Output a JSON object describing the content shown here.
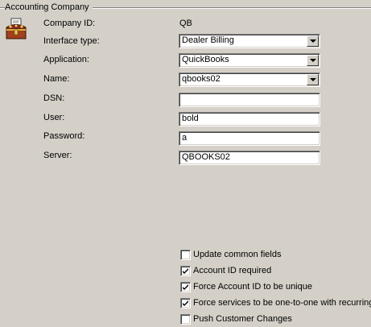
{
  "group": {
    "title": "Accounting Company"
  },
  "icons": {
    "app": "treasure-chest-icon",
    "checkmark": "checkmark-icon",
    "dropdown": "chevron-down-icon"
  },
  "fields": {
    "company_id": {
      "label": "Company ID:",
      "value": "QB"
    },
    "interface_type": {
      "label": "Interface type:",
      "value": "Dealer Billing"
    },
    "application": {
      "label": "Application:",
      "value": "QuickBooks"
    },
    "name": {
      "label": "Name:",
      "value": "qbooks02"
    },
    "dsn": {
      "label": "DSN:",
      "value": ""
    },
    "user": {
      "label": "User:",
      "value": "bold"
    },
    "password": {
      "label": "Password:",
      "value": "a"
    },
    "server": {
      "label": "Server:",
      "value": "QBOOKS02"
    }
  },
  "options": {
    "update_common_fields": {
      "label": "Update common fields",
      "checked": false
    },
    "account_id_required": {
      "label": "Account ID required",
      "checked": true
    },
    "force_unique_account_id": {
      "label": "Force Account ID to be unique",
      "checked": true
    },
    "force_services_one_to_one": {
      "label": "Force services to be one-to-one with recurring",
      "checked": true
    },
    "push_customer_changes": {
      "label": "Push Customer Changes",
      "checked": false
    }
  }
}
